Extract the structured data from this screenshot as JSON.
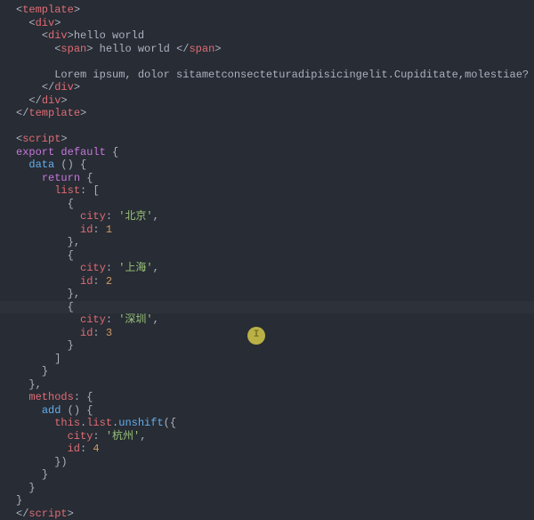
{
  "cursor": {
    "line": 26,
    "col": 10
  },
  "lines": [
    [
      {
        "c": "punct",
        "t": "<"
      },
      {
        "c": "tag",
        "t": "template"
      },
      {
        "c": "punct",
        "t": ">"
      }
    ],
    [
      {
        "c": "text",
        "t": "  "
      },
      {
        "c": "punct",
        "t": "<"
      },
      {
        "c": "tag",
        "t": "div"
      },
      {
        "c": "punct",
        "t": ">"
      }
    ],
    [
      {
        "c": "text",
        "t": "    "
      },
      {
        "c": "punct",
        "t": "<"
      },
      {
        "c": "tag",
        "t": "div"
      },
      {
        "c": "punct",
        "t": ">"
      },
      {
        "c": "text",
        "t": "hello world"
      }
    ],
    [
      {
        "c": "text",
        "t": "      "
      },
      {
        "c": "punct",
        "t": "<"
      },
      {
        "c": "tag",
        "t": "span"
      },
      {
        "c": "punct",
        "t": ">"
      },
      {
        "c": "text",
        "t": " hello world "
      },
      {
        "c": "punct",
        "t": "</"
      },
      {
        "c": "tag",
        "t": "span"
      },
      {
        "c": "punct",
        "t": ">"
      }
    ],
    [
      {
        "c": "text",
        "t": ""
      }
    ],
    [
      {
        "c": "text",
        "t": "      Lorem ipsum, dolor sitametconsecteturadipisicingelit.Cupiditate,molestiae?"
      }
    ],
    [
      {
        "c": "text",
        "t": "    "
      },
      {
        "c": "punct",
        "t": "</"
      },
      {
        "c": "tag",
        "t": "div"
      },
      {
        "c": "punct",
        "t": ">"
      }
    ],
    [
      {
        "c": "text",
        "t": "  "
      },
      {
        "c": "punct",
        "t": "</"
      },
      {
        "c": "tag",
        "t": "div"
      },
      {
        "c": "punct",
        "t": ">"
      }
    ],
    [
      {
        "c": "punct",
        "t": "</"
      },
      {
        "c": "tag",
        "t": "template"
      },
      {
        "c": "punct",
        "t": ">"
      }
    ],
    [
      {
        "c": "text",
        "t": ""
      }
    ],
    [
      {
        "c": "punct",
        "t": "<"
      },
      {
        "c": "tag",
        "t": "script"
      },
      {
        "c": "punct",
        "t": ">"
      }
    ],
    [
      {
        "c": "key",
        "t": "export"
      },
      {
        "c": "text",
        "t": " "
      },
      {
        "c": "key",
        "t": "default"
      },
      {
        "c": "text",
        "t": " "
      },
      {
        "c": "brace",
        "t": "{"
      }
    ],
    [
      {
        "c": "text",
        "t": "  "
      },
      {
        "c": "func",
        "t": "data"
      },
      {
        "c": "text",
        "t": " "
      },
      {
        "c": "brace",
        "t": "()"
      },
      {
        "c": "text",
        "t": " "
      },
      {
        "c": "brace",
        "t": "{"
      }
    ],
    [
      {
        "c": "text",
        "t": "    "
      },
      {
        "c": "key",
        "t": "return"
      },
      {
        "c": "text",
        "t": " "
      },
      {
        "c": "brace",
        "t": "{"
      }
    ],
    [
      {
        "c": "text",
        "t": "      "
      },
      {
        "c": "prop",
        "t": "list"
      },
      {
        "c": "punct",
        "t": ":"
      },
      {
        "c": "text",
        "t": " "
      },
      {
        "c": "brace",
        "t": "["
      }
    ],
    [
      {
        "c": "text",
        "t": "        "
      },
      {
        "c": "brace",
        "t": "{"
      }
    ],
    [
      {
        "c": "text",
        "t": "          "
      },
      {
        "c": "prop",
        "t": "city"
      },
      {
        "c": "punct",
        "t": ":"
      },
      {
        "c": "text",
        "t": " "
      },
      {
        "c": "str",
        "t": "'北京'"
      },
      {
        "c": "punct",
        "t": ","
      }
    ],
    [
      {
        "c": "text",
        "t": "          "
      },
      {
        "c": "prop",
        "t": "id"
      },
      {
        "c": "punct",
        "t": ":"
      },
      {
        "c": "text",
        "t": " "
      },
      {
        "c": "num",
        "t": "1"
      }
    ],
    [
      {
        "c": "text",
        "t": "        "
      },
      {
        "c": "brace",
        "t": "}"
      },
      {
        "c": "punct",
        "t": ","
      }
    ],
    [
      {
        "c": "text",
        "t": "        "
      },
      {
        "c": "brace",
        "t": "{"
      }
    ],
    [
      {
        "c": "text",
        "t": "          "
      },
      {
        "c": "prop",
        "t": "city"
      },
      {
        "c": "punct",
        "t": ":"
      },
      {
        "c": "text",
        "t": " "
      },
      {
        "c": "str",
        "t": "'上海'"
      },
      {
        "c": "punct",
        "t": ","
      }
    ],
    [
      {
        "c": "text",
        "t": "          "
      },
      {
        "c": "prop",
        "t": "id"
      },
      {
        "c": "punct",
        "t": ":"
      },
      {
        "c": "text",
        "t": " "
      },
      {
        "c": "num",
        "t": "2"
      }
    ],
    [
      {
        "c": "text",
        "t": "        "
      },
      {
        "c": "brace",
        "t": "}"
      },
      {
        "c": "punct",
        "t": ","
      }
    ],
    [
      {
        "c": "text",
        "t": "        "
      },
      {
        "c": "brace",
        "t": "{"
      },
      {
        "highlight": true
      }
    ],
    [
      {
        "c": "text",
        "t": "          "
      },
      {
        "c": "prop",
        "t": "city"
      },
      {
        "c": "punct",
        "t": ":"
      },
      {
        "c": "text",
        "t": " "
      },
      {
        "c": "str",
        "t": "'深圳'"
      },
      {
        "c": "punct",
        "t": ","
      }
    ],
    [
      {
        "c": "text",
        "t": "          "
      },
      {
        "c": "prop",
        "t": "id"
      },
      {
        "c": "punct",
        "t": ":"
      },
      {
        "c": "text",
        "t": " "
      },
      {
        "c": "num",
        "t": "3"
      }
    ],
    [
      {
        "c": "text",
        "t": "        "
      },
      {
        "c": "brace",
        "t": "}"
      }
    ],
    [
      {
        "c": "text",
        "t": "      "
      },
      {
        "c": "brace",
        "t": "]"
      }
    ],
    [
      {
        "c": "text",
        "t": "    "
      },
      {
        "c": "brace",
        "t": "}"
      }
    ],
    [
      {
        "c": "text",
        "t": "  "
      },
      {
        "c": "brace",
        "t": "}"
      },
      {
        "c": "punct",
        "t": ","
      }
    ],
    [
      {
        "c": "text",
        "t": "  "
      },
      {
        "c": "prop",
        "t": "methods"
      },
      {
        "c": "punct",
        "t": ":"
      },
      {
        "c": "text",
        "t": " "
      },
      {
        "c": "brace",
        "t": "{"
      }
    ],
    [
      {
        "c": "text",
        "t": "    "
      },
      {
        "c": "func",
        "t": "add"
      },
      {
        "c": "text",
        "t": " "
      },
      {
        "c": "brace",
        "t": "()"
      },
      {
        "c": "text",
        "t": " "
      },
      {
        "c": "brace",
        "t": "{"
      }
    ],
    [
      {
        "c": "text",
        "t": "      "
      },
      {
        "c": "this",
        "t": "this"
      },
      {
        "c": "punct",
        "t": "."
      },
      {
        "c": "prop",
        "t": "list"
      },
      {
        "c": "punct",
        "t": "."
      },
      {
        "c": "func",
        "t": "unshift"
      },
      {
        "c": "brace",
        "t": "({"
      }
    ],
    [
      {
        "c": "text",
        "t": "        "
      },
      {
        "c": "prop",
        "t": "city"
      },
      {
        "c": "punct",
        "t": ":"
      },
      {
        "c": "text",
        "t": " "
      },
      {
        "c": "str",
        "t": "'杭州'"
      },
      {
        "c": "punct",
        "t": ","
      }
    ],
    [
      {
        "c": "text",
        "t": "        "
      },
      {
        "c": "prop",
        "t": "id"
      },
      {
        "c": "punct",
        "t": ":"
      },
      {
        "c": "text",
        "t": " "
      },
      {
        "c": "num",
        "t": "4"
      }
    ],
    [
      {
        "c": "text",
        "t": "      "
      },
      {
        "c": "brace",
        "t": "})"
      }
    ],
    [
      {
        "c": "text",
        "t": "    "
      },
      {
        "c": "brace",
        "t": "}"
      }
    ],
    [
      {
        "c": "text",
        "t": "  "
      },
      {
        "c": "brace",
        "t": "}"
      }
    ],
    [
      {
        "c": "brace",
        "t": "}"
      }
    ],
    [
      {
        "c": "punct",
        "t": "</"
      },
      {
        "c": "tag",
        "t": "script"
      },
      {
        "c": "punct",
        "t": ">"
      }
    ]
  ]
}
